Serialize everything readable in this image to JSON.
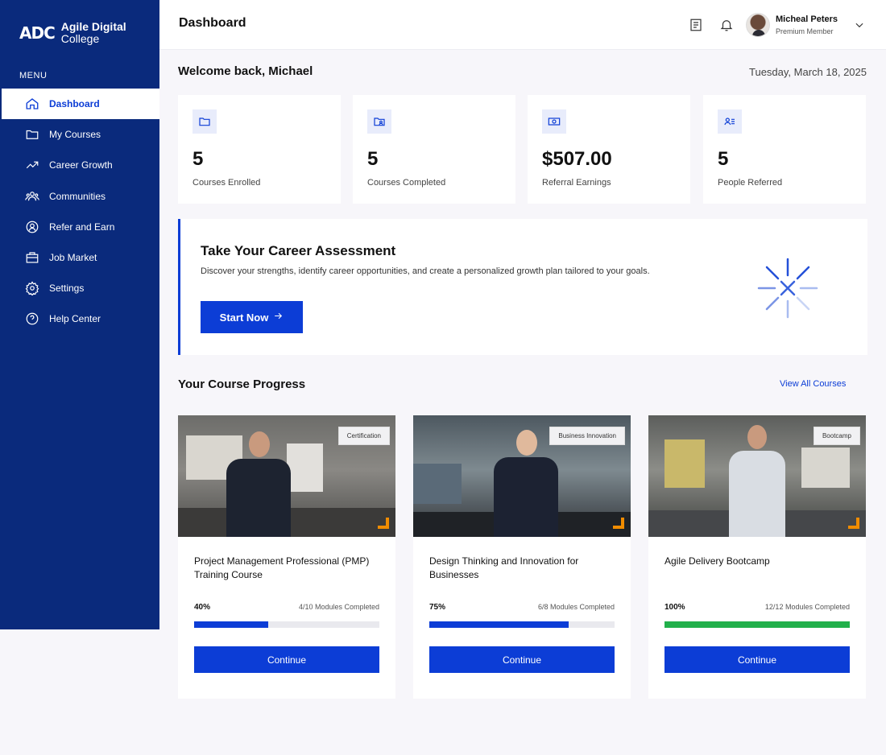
{
  "brand": {
    "mark": "ADC",
    "line1": "Agile Digital",
    "line2": "College"
  },
  "sidebar": {
    "menu_label": "MENU",
    "items": [
      {
        "label": "Dashboard",
        "icon": "home-icon",
        "active": true
      },
      {
        "label": "My Courses",
        "icon": "folder-icon"
      },
      {
        "label": "Career Growth",
        "icon": "trend-icon"
      },
      {
        "label": "Communities",
        "icon": "users-icon"
      },
      {
        "label": "Refer and Earn",
        "icon": "refer-icon"
      },
      {
        "label": "Job Market",
        "icon": "briefcase-icon"
      },
      {
        "label": "Settings",
        "icon": "gear-icon"
      },
      {
        "label": "Help Center",
        "icon": "help-icon"
      }
    ]
  },
  "header": {
    "title": "Dashboard",
    "user_name": "Micheal Peters",
    "user_role": "Premium Member"
  },
  "welcome": {
    "greeting": "Welcome back, Michael",
    "date": "Tuesday, March 18, 2025"
  },
  "stats": [
    {
      "value": "5",
      "label": "Courses Enrolled",
      "icon": "folder-icon"
    },
    {
      "value": "5",
      "label": "Courses Completed",
      "icon": "folder-user-icon"
    },
    {
      "value": "$507.00",
      "label": "Referral Earnings",
      "icon": "money-icon"
    },
    {
      "value": "5",
      "label": "People Referred",
      "icon": "person-list-icon"
    }
  ],
  "assessment": {
    "title": "Take Your Career Assessment",
    "description": "Discover your strengths, identify career opportunities, and create a personalized growth plan tailored to your goals.",
    "button": "Start Now"
  },
  "progress": {
    "title": "Your Course Progress",
    "view_all": "View All Courses",
    "courses": [
      {
        "tag": "Certification",
        "title": "Project Management Professional (PMP) Training Course",
        "percent_label": "40%",
        "percent": 40,
        "modules": "4/10 Modules Completed",
        "button": "Continue"
      },
      {
        "tag": "Business Innovation",
        "title": "Design Thinking and Innovation for Businesses",
        "percent_label": "75%",
        "percent": 75,
        "modules": "6/8 Modules Completed",
        "button": "Continue"
      },
      {
        "tag": "Bootcamp",
        "title": "Agile Delivery Bootcamp",
        "percent_label": "100%",
        "percent": 100,
        "modules": "12/12 Modules Completed",
        "button": "Continue"
      }
    ]
  },
  "colors": {
    "sidebar": "#0a2a7c",
    "accent": "#0c3dd6",
    "complete": "#22b04b",
    "corner": "#f08c00"
  }
}
